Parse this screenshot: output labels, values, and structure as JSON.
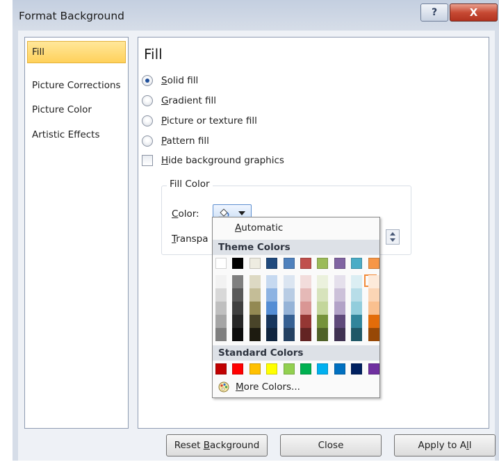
{
  "window": {
    "title": "Format Background",
    "help_label": "?",
    "close_label": "X"
  },
  "sidebar": {
    "items": [
      {
        "label": "Fill",
        "selected": true
      },
      {
        "label": "Picture Corrections",
        "selected": false
      },
      {
        "label": "Picture Color",
        "selected": false
      },
      {
        "label": "Artistic Effects",
        "selected": false
      }
    ]
  },
  "panel": {
    "title": "Fill",
    "options": [
      {
        "accel": "S",
        "rest": "olid fill",
        "checked": true
      },
      {
        "accel": "G",
        "rest": "radient fill",
        "checked": false
      },
      {
        "accel": "P",
        "rest": "icture or texture fill",
        "checked": false
      },
      {
        "accel": "P",
        "rest": "attern fill",
        "checked": false
      }
    ],
    "hide_bg": {
      "accel": "H",
      "rest": "ide background graphics",
      "checked": false
    },
    "fill_color": {
      "group_title": "Fill Color",
      "color_label_accel": "C",
      "color_label_rest": "olor:",
      "transparency_accel": "T",
      "transparency_rest": "ranspa"
    }
  },
  "color_menu": {
    "automatic_accel": "A",
    "automatic_rest": "utomatic",
    "theme_header": "Theme Colors",
    "theme_colors": [
      "#ffffff",
      "#000000",
      "#eeece1",
      "#1f497d",
      "#4f81bd",
      "#c0504d",
      "#9bbb59",
      "#8064a2",
      "#4bacc6",
      "#f79646"
    ],
    "theme_shades": [
      [
        "#f2f2f2",
        "#d8d8d8",
        "#bfbfbf",
        "#a5a5a5",
        "#7f7f7f"
      ],
      [
        "#7f7f7f",
        "#595959",
        "#3f3f3f",
        "#262626",
        "#0c0c0c"
      ],
      [
        "#ddd9c3",
        "#c4bd97",
        "#938953",
        "#494429",
        "#1d1b10"
      ],
      [
        "#c6d9f0",
        "#8db3e2",
        "#548dd4",
        "#17365d",
        "#0f243e"
      ],
      [
        "#dbe5f1",
        "#b8cce4",
        "#95b3d7",
        "#366092",
        "#244061"
      ],
      [
        "#f2dcdb",
        "#e5b9b7",
        "#d99694",
        "#953734",
        "#632423"
      ],
      [
        "#ebf1dd",
        "#d7e3bc",
        "#c3d69b",
        "#76923c",
        "#4f6128"
      ],
      [
        "#e5e0ec",
        "#ccc1d9",
        "#b2a2c7",
        "#5f497a",
        "#3f3151"
      ],
      [
        "#dbeef3",
        "#b7dde8",
        "#92cddc",
        "#31859b",
        "#205867"
      ],
      [
        "#fdeada",
        "#fbd5b5",
        "#fac08f",
        "#e36c09",
        "#974806"
      ]
    ],
    "standard_header": "Standard Colors",
    "standard_colors": [
      "#c00000",
      "#ff0000",
      "#ffc000",
      "#ffff00",
      "#92d050",
      "#00b050",
      "#00b0f0",
      "#0070c0",
      "#002060",
      "#7030a0"
    ],
    "more_accel": "M",
    "more_rest": "ore Colors..."
  },
  "footer": {
    "reset_pre": "Reset ",
    "reset_accel": "B",
    "reset_rest": "ackground",
    "close_label": "Close",
    "apply_pre": "Apply to A",
    "apply_accel": "l",
    "apply_rest": "l"
  }
}
